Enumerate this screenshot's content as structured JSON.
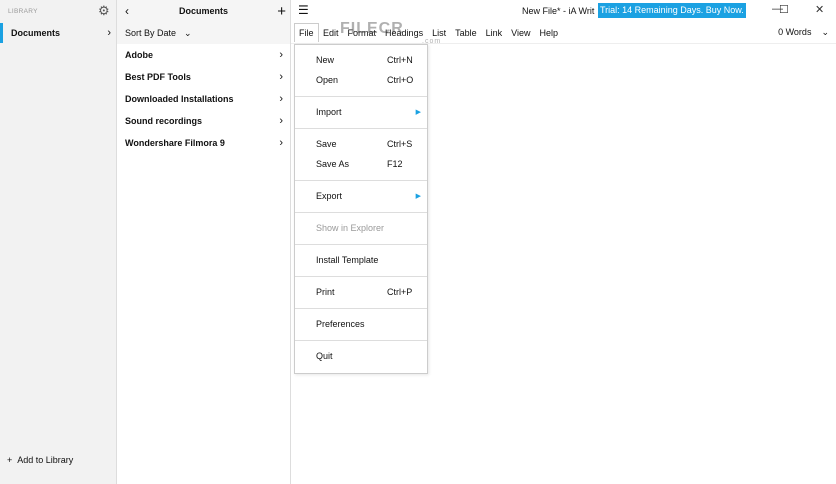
{
  "sidebar": {
    "label": "LIBRARY",
    "items": [
      {
        "label": "Documents"
      }
    ],
    "add_label": "Add to Library"
  },
  "middle": {
    "title": "Documents",
    "sort_label": "Sort By Date",
    "folders": [
      "Adobe",
      "Best PDF Tools",
      "Downloaded Installations",
      "Sound recordings",
      "Wondershare Filmora 9"
    ]
  },
  "window": {
    "title": "New File*  - iA Writ",
    "trial": "Trial: 14 Remaining Days. Buy Now."
  },
  "menubar": {
    "items": [
      "File",
      "Edit",
      "Format",
      "Headings",
      "List",
      "Table",
      "Link",
      "View",
      "Help"
    ],
    "word_count": "0 Words"
  },
  "file_menu": {
    "new": "New",
    "new_sc": "Ctrl+N",
    "open": "Open",
    "open_sc": "Ctrl+O",
    "import": "Import",
    "save": "Save",
    "save_sc": "Ctrl+S",
    "save_as": "Save As",
    "save_as_sc": "F12",
    "export": "Export",
    "show": "Show in Explorer",
    "template": "Install Template",
    "print": "Print",
    "print_sc": "Ctrl+P",
    "prefs": "Preferences",
    "quit": "Quit"
  },
  "watermark": {
    "text": "FILECR",
    "sub": ".com"
  },
  "colors": {
    "accent": "#1ba1e2"
  }
}
